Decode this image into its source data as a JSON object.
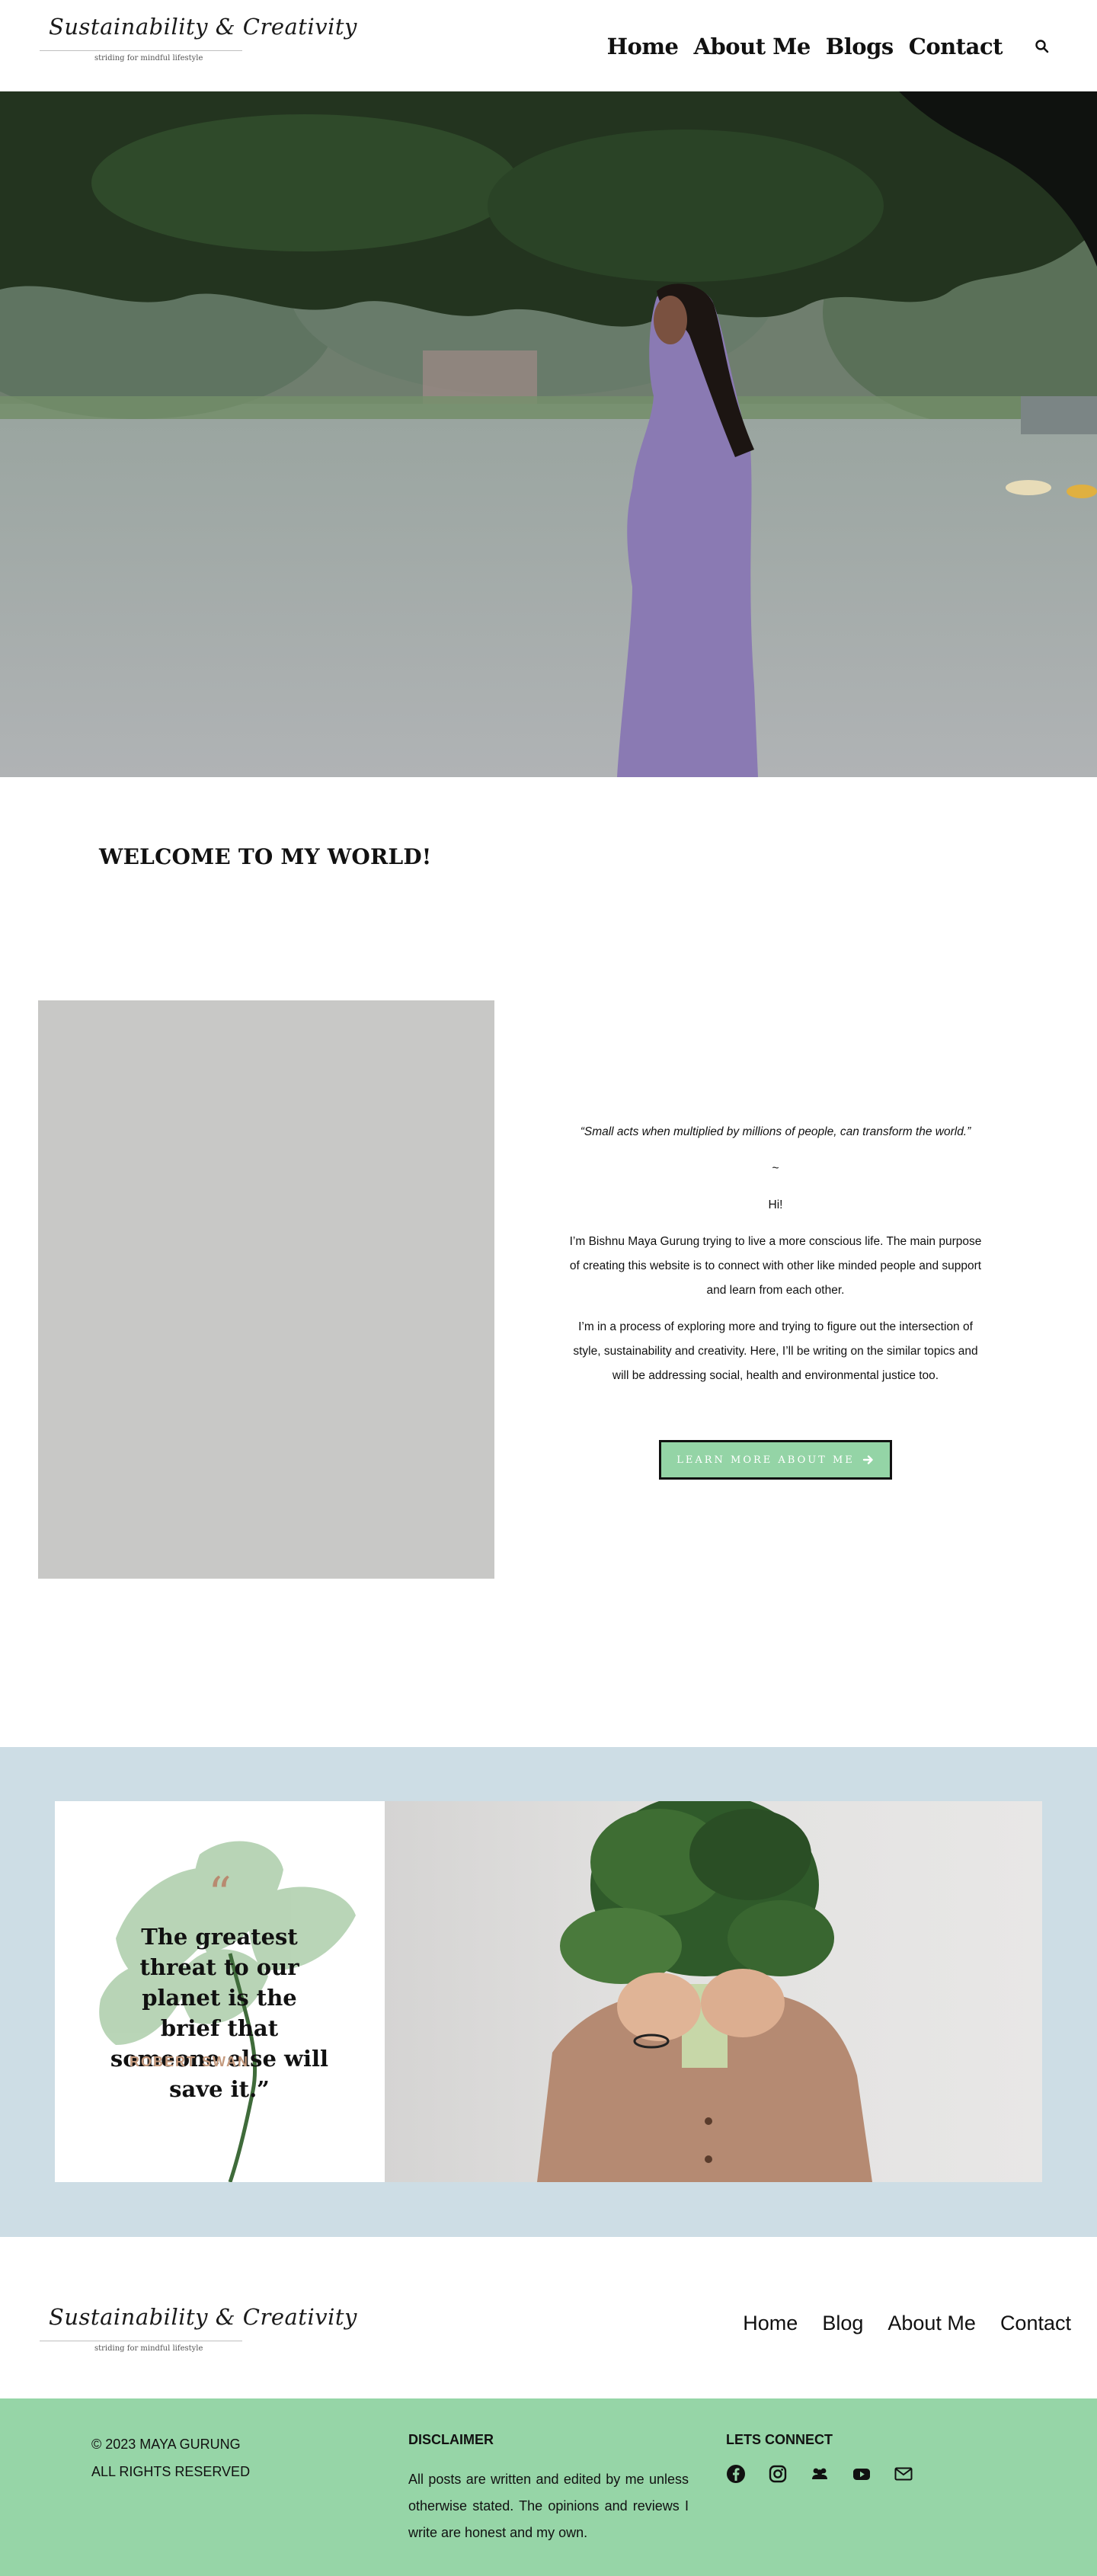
{
  "header": {
    "logo_script": "Sustainability & Creativity",
    "logo_tagline": "striding for mindful lifestyle",
    "nav": [
      "Home",
      "About Me",
      "Blogs",
      "Contact"
    ],
    "search_icon": "search-icon"
  },
  "welcome": {
    "heading": "WELCOME TO MY WORLD!"
  },
  "about": {
    "quote": "“Small acts when multiplied by millions of people, can transform the world.”",
    "tilde": "~",
    "greeting": "Hi!",
    "para1": "I’m Bishnu Maya Gurung trying to live a more conscious life. The main purpose of creating this website is to connect with other like minded people and support and learn from each other.",
    "para2": "I’m in a process of exploring more and trying to figure out the intersection of style, sustainability and creativity. Here, I’ll be writing on the similar topics and will be addressing  social, health and environmental justice too.",
    "cta_label": "LEARN MORE ABOUT ME",
    "cta_icon": "arrow-right-icon"
  },
  "quote_block": {
    "mark": "“",
    "text": "The greatest threat to our planet is the brief that someone else will save it.”",
    "author": "ROBERT SWAN"
  },
  "footer_nav": [
    "Home",
    "Blog",
    "About Me",
    "Contact"
  ],
  "footer": {
    "copyright": "© 2023 MAYA GURUNG",
    "rights": "ALL RIGHTS RESERVED",
    "disclaimer_heading": "DISCLAIMER",
    "disclaimer_text": "All posts are written and edited by me unless otherwise stated. The opinions and reviews I write are honest and my own.",
    "connect_heading": "LETS CONNECT",
    "socials": [
      "facebook-icon",
      "instagram-icon",
      "group-icon",
      "youtube-icon",
      "email-icon"
    ]
  },
  "colors": {
    "accent_green": "#96d5a7",
    "quote_bg": "#cddde5",
    "author_color": "#c49a7e",
    "placeholder_gray": "#c8c8c6"
  }
}
